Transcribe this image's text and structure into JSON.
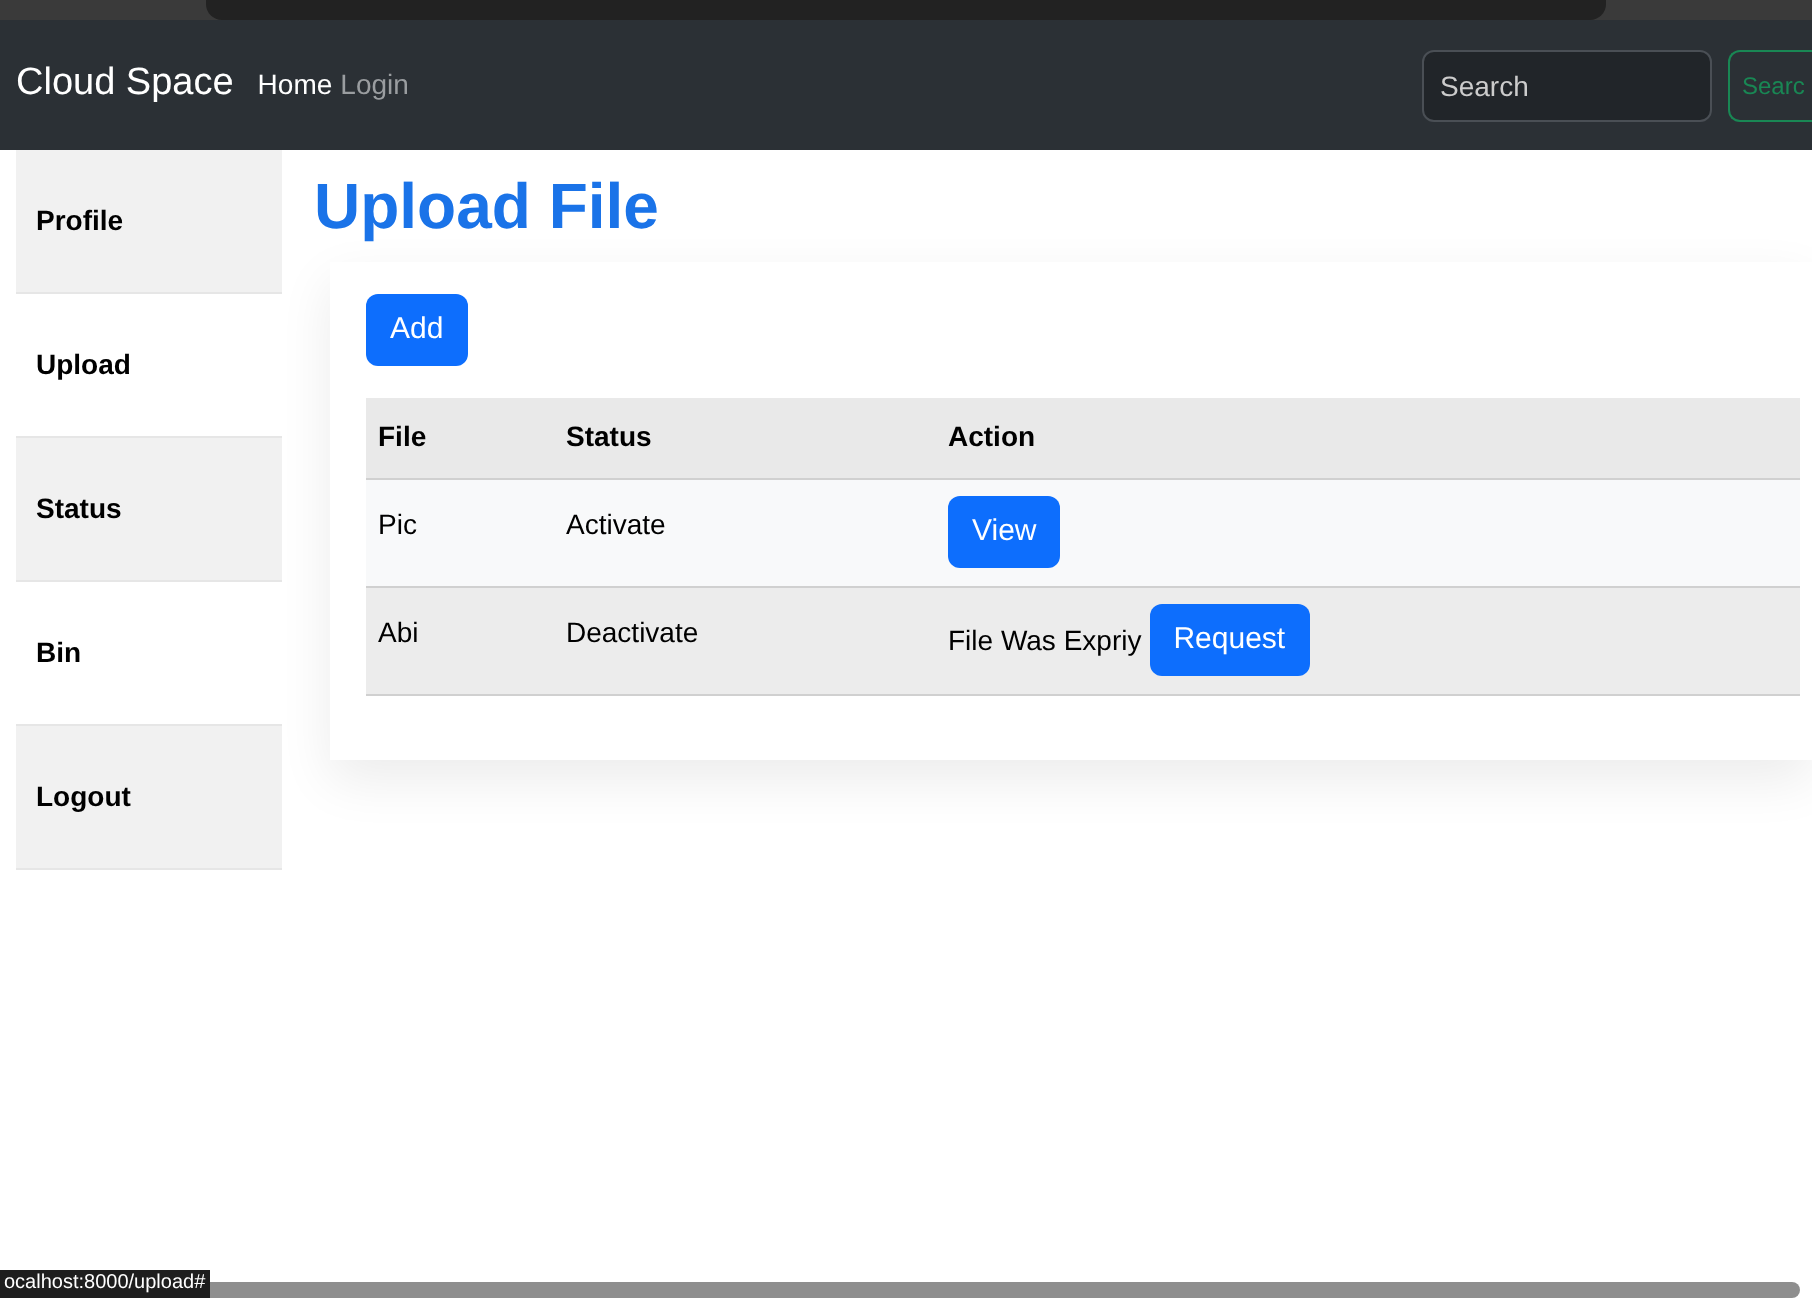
{
  "navbar": {
    "brand": "Cloud Space",
    "links": [
      {
        "label": "Home",
        "selected": true
      },
      {
        "label": "Login",
        "selected": false
      }
    ],
    "search": {
      "placeholder": "Search"
    },
    "search_button": "Searc"
  },
  "sidebar": {
    "items": [
      {
        "label": "Profile"
      },
      {
        "label": "Upload"
      },
      {
        "label": "Status"
      },
      {
        "label": "Bin"
      },
      {
        "label": "Logout"
      }
    ]
  },
  "page": {
    "title": "Upload File",
    "add_button": "Add"
  },
  "table": {
    "columns": [
      "File",
      "Status",
      "Action"
    ],
    "rows": [
      {
        "file": "Pic",
        "status": "Activate",
        "action": {
          "kind": "button",
          "label": "View"
        }
      },
      {
        "file": "Abi",
        "status": "Deactivate",
        "action": {
          "kind": "note_button",
          "note": "File Was Expriy",
          "label": "Request"
        }
      }
    ]
  },
  "status_bar": {
    "url": "ocalhost:8000/upload#"
  }
}
